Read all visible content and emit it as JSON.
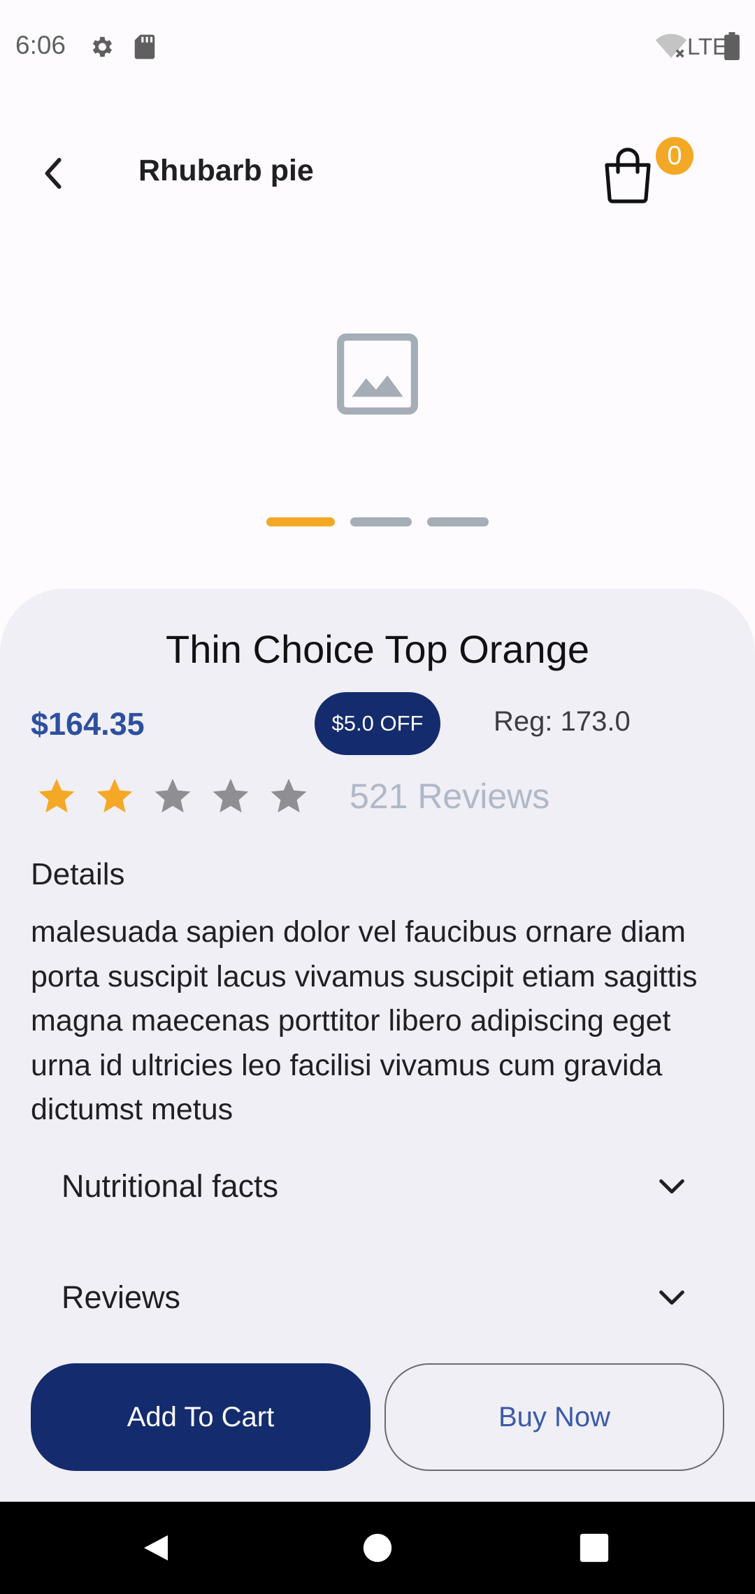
{
  "status_bar": {
    "time": "6:06",
    "network": "LTE",
    "icons": [
      "gear-icon",
      "sd-card-icon",
      "wifi-icon",
      "battery-icon"
    ]
  },
  "app_bar": {
    "title": "Rhubarb pie",
    "cart_count": "0",
    "icons": [
      "chevron-left-icon",
      "shopping-bag-icon"
    ]
  },
  "gallery": {
    "image_icon": "image-placeholder-icon",
    "slide_count": 3,
    "active_slide": 1
  },
  "product": {
    "name": "Thin Choice Top Orange",
    "price": "$164.35",
    "discount": "$5.0 OFF",
    "regular_price": "Reg: 173.0",
    "rating": 2,
    "rating_max": 5,
    "reviews_label": "521 Reviews",
    "details_heading": "Details",
    "details_text": "malesuada sapien dolor vel faucibus ornare diam porta suscipit lacus vivamus suscipit etiam sagittis magna maecenas porttitor libero adipiscing eget urna id ultricies leo facilisi vivamus cum gravida dictumst metus"
  },
  "sections": [
    {
      "label": "Nutritional facts"
    },
    {
      "label": "Reviews"
    }
  ],
  "actions": {
    "add_to_cart": "Add To Cart",
    "buy_now": "Buy Now"
  },
  "colors": {
    "primary": "#142c6e",
    "accent": "#f4a825",
    "price": "#2d4f9e",
    "star_filled": "#f4a825",
    "star_empty": "#8e8e93"
  }
}
